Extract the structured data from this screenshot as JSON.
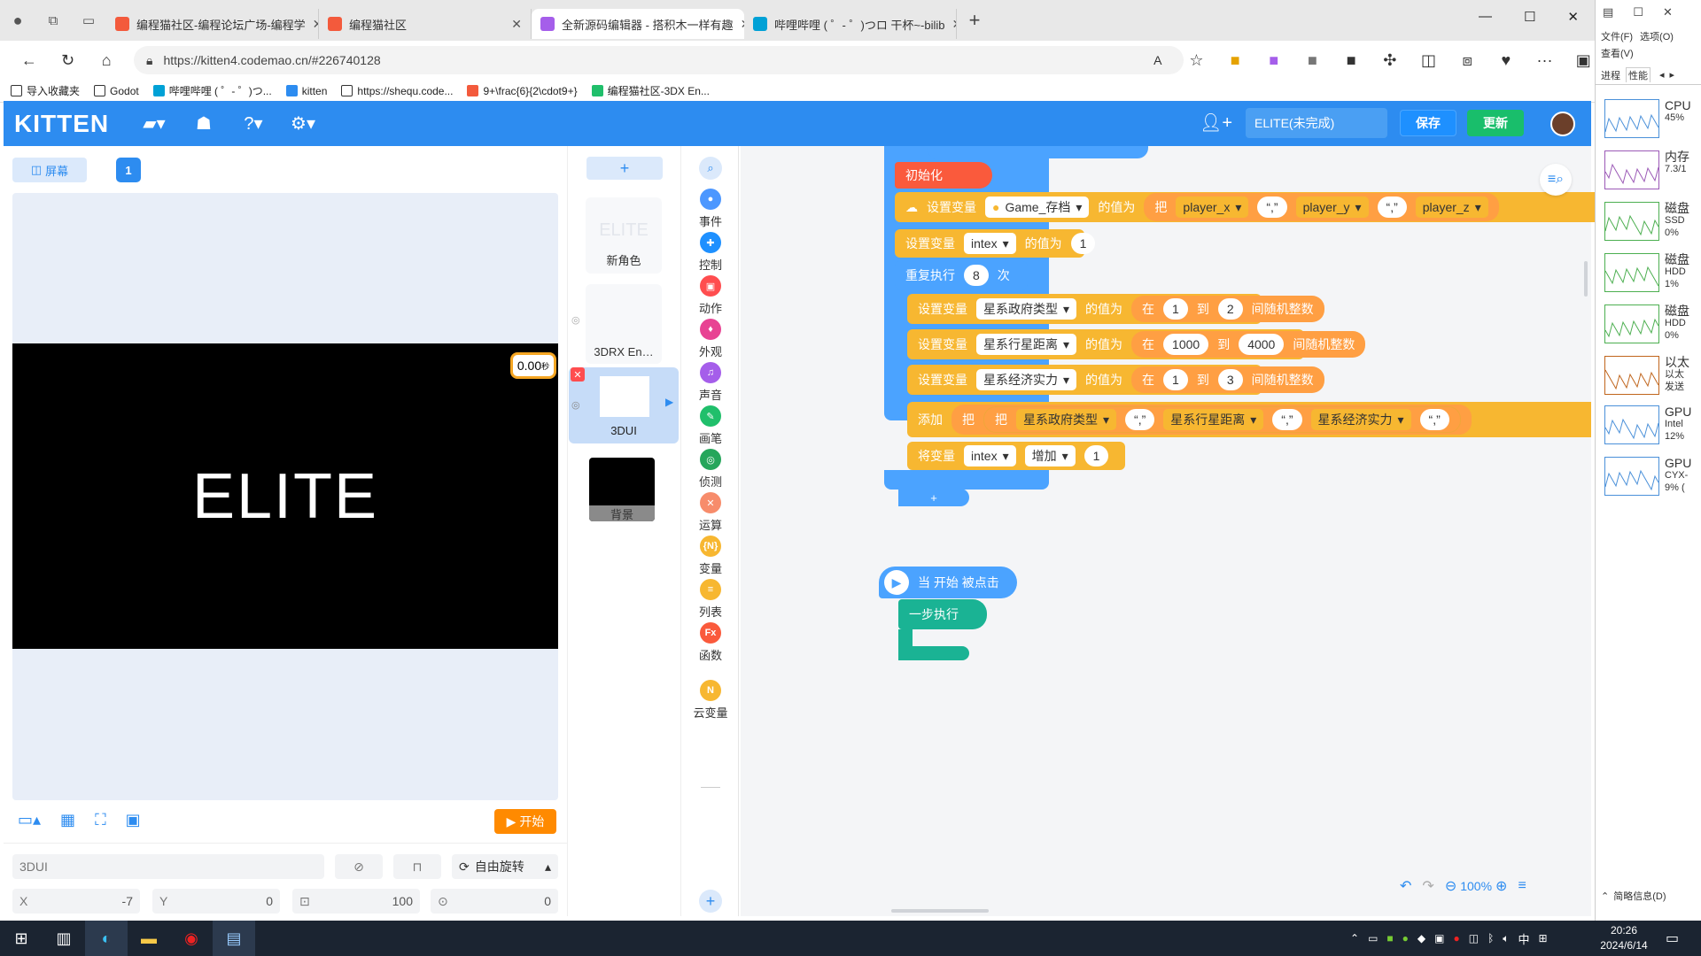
{
  "browser": {
    "tabs": [
      {
        "title": "编程猫社区-编程论坛广场-编程学",
        "active": false
      },
      {
        "title": "编程猫社区",
        "active": false
      },
      {
        "title": "全新源码编辑器 - 搭积木一样有趣",
        "active": true
      },
      {
        "title": "哔哩哔哩 ( ゜- ゜)つロ 干杯~-bilib",
        "active": false
      }
    ],
    "url": "https://kitten4.codemao.cn/#226740128",
    "favorites": [
      "导入收藏夹",
      "Godot",
      "哔哩哔哩 ( ゜- ゜)つ...",
      "kitten",
      "https://shequ.code...",
      "9+\\frac{6}{2\\cdot9+}",
      "编程猫社区-3DX En..."
    ],
    "window_controls": {
      "minimize": "—",
      "maximize": "☐",
      "close": "✕"
    }
  },
  "app": {
    "logo": "KITTEN",
    "project_name": "ELITE(未完成)",
    "save_label": "保存",
    "update_label": "更新",
    "accent": "#2d8cf0"
  },
  "stage": {
    "screen_tab": "屏幕",
    "screen_number": "1",
    "stage_text": "ELITE",
    "timer": "0.00",
    "timer_unit": "秒",
    "start_label": "开始",
    "sprite_name": "3DUI",
    "rotate_label": "自由旋转",
    "x_label": "X",
    "x_value": "-7",
    "y_label": "Y",
    "y_value": "0",
    "size_value": "100",
    "rotation_value": "0"
  },
  "sprites": [
    {
      "name": "新角色",
      "thumb": "ELITE"
    },
    {
      "name": "3DRX En…"
    },
    {
      "name": "3DUI",
      "selected": true
    },
    {
      "name": "背景"
    }
  ],
  "categories": [
    {
      "label": "事件",
      "color": "#4c97ff"
    },
    {
      "label": "控制",
      "color": "#1e90ff"
    },
    {
      "label": "动作",
      "color": "#ff4d4f"
    },
    {
      "label": "外观",
      "color": "#e84393"
    },
    {
      "label": "声音",
      "color": "#a55eea"
    },
    {
      "label": "画笔",
      "color": "#20bf6b"
    },
    {
      "label": "侦测",
      "color": "#26a65b"
    },
    {
      "label": "运算",
      "color": "#f78c6b"
    },
    {
      "label": "变量",
      "color": "#f7b731"
    },
    {
      "label": "列表",
      "color": "#f7b731"
    },
    {
      "label": "函数",
      "color": "#fa5a3c"
    },
    {
      "label": "云变量",
      "color": "#f7b731"
    }
  ],
  "blocks": {
    "init": "初始化",
    "set_var": "设置变量",
    "value_of": "的值为",
    "game_save": "Game_存档",
    "ba": "把",
    "player_x": "player_x",
    "player_y": "player_y",
    "player_z": "player_z",
    "comma": "“,”",
    "intex": "intex",
    "one": "1",
    "repeat": "重复执行",
    "repeat_n": "8",
    "times": "次",
    "gov_type": "星系政府类型",
    "planet_dist": "星系行星距离",
    "economy": "星系经济实力",
    "zai": "在",
    "dao": "到",
    "random_int": "间随机整数",
    "r1_from": "1",
    "r1_to": "2",
    "r2_from": "1000",
    "r2_to": "4000",
    "r3_from": "1",
    "r3_to": "3",
    "add": "添加",
    "change_var": "将变量",
    "increase": "增加",
    "when_start": "当 开始 被点击",
    "step_exec": "一步执行",
    "plus": "+"
  },
  "zoom": "100%",
  "taskmgr": {
    "menu": [
      "文件(F)",
      "选项(O)",
      "查看(V)"
    ],
    "tabs": [
      "进程",
      "性能"
    ],
    "items": [
      {
        "name": "CPU",
        "l1": "45%",
        "l2": ""
      },
      {
        "name": "内存",
        "l1": "7.3/1",
        "l2": ""
      },
      {
        "name": "磁盘",
        "l1": "SSD",
        "l2": "0%"
      },
      {
        "name": "磁盘",
        "l1": "HDD",
        "l2": "1%"
      },
      {
        "name": "磁盘",
        "l1": "HDD",
        "l2": "0%"
      },
      {
        "name": "以太",
        "l1": "以太",
        "l2": "发送"
      },
      {
        "name": "GPU",
        "l1": "Intel",
        "l2": "12%"
      },
      {
        "name": "GPU",
        "l1": "CYX-",
        "l2": "9% ("
      }
    ],
    "summary": "简略信息(D)"
  },
  "taskbar": {
    "time": "20:26",
    "date": "2024/6/14",
    "ime": "中"
  }
}
